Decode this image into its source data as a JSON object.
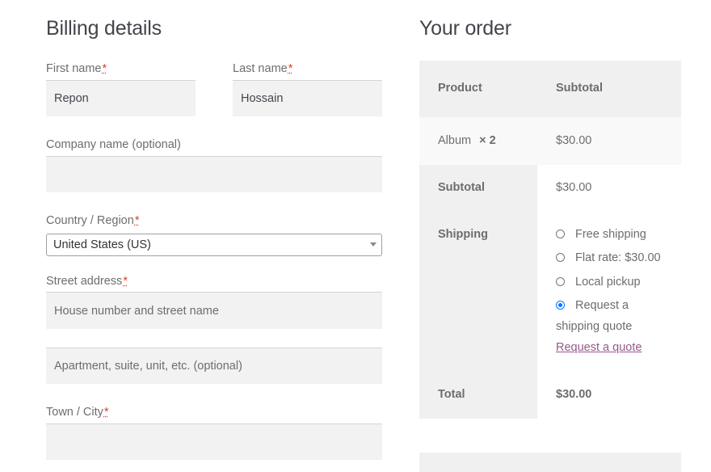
{
  "billing": {
    "title": "Billing details",
    "required_mark": "*",
    "first_name": {
      "label": "First name",
      "value": "Repon"
    },
    "last_name": {
      "label": "Last name",
      "value": "Hossain"
    },
    "company": {
      "label": "Company name (optional)",
      "value": ""
    },
    "country": {
      "label": "Country / Region",
      "value": "United States (US)"
    },
    "street": {
      "label": "Street address",
      "placeholder_1": "House number and street name",
      "placeholder_2": "Apartment, suite, unit, etc. (optional)"
    },
    "city": {
      "label": "Town / City",
      "value": ""
    }
  },
  "order": {
    "title": "Your order",
    "col_product": "Product",
    "col_subtotal": "Subtotal",
    "item": {
      "name": "Album",
      "qty": "× 2",
      "price": "$30.00"
    },
    "subtotal_label": "Subtotal",
    "subtotal_value": "$30.00",
    "shipping_label": "Shipping",
    "shipping_options": [
      {
        "label": "Free shipping",
        "selected": false
      },
      {
        "label": "Flat rate: $30.00",
        "selected": false
      },
      {
        "label": "Local pickup",
        "selected": false
      },
      {
        "label": "Request a",
        "label_cont": "shipping quote",
        "selected": true
      }
    ],
    "request_link": "Request a quote",
    "total_label": "Total",
    "total_value": "$30.00"
  },
  "colors": {
    "accent_link": "#96588a",
    "required": "#e2401c",
    "radio_selected": "#0075ff",
    "table_bg": "#f8f8f8"
  }
}
